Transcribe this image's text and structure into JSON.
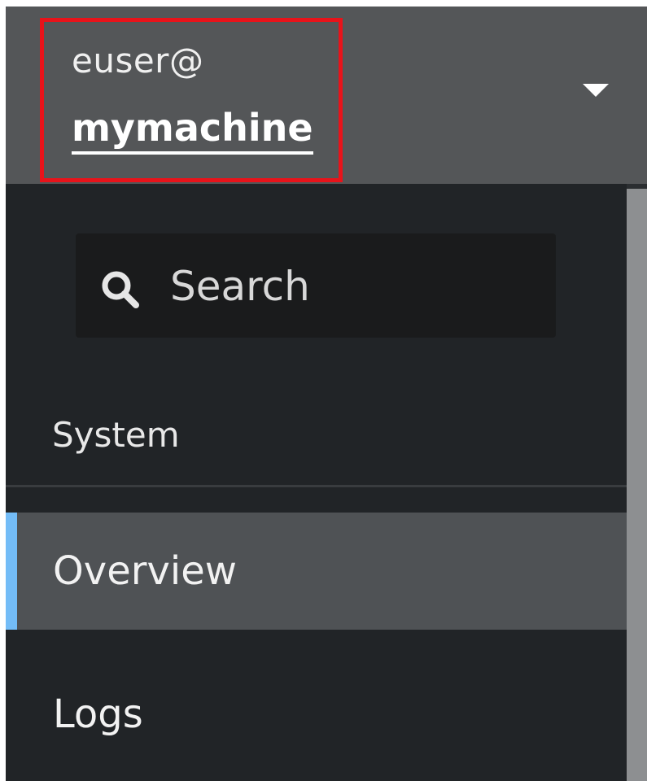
{
  "host": {
    "user": "euser@",
    "machine": "mymachine",
    "dropdown_icon": "caret-down-icon"
  },
  "search": {
    "placeholder": "Search",
    "icon": "search-icon"
  },
  "nav": {
    "section_title": "System",
    "items": [
      {
        "label": "Overview",
        "active": true
      },
      {
        "label": "Logs",
        "active": false
      }
    ]
  },
  "colors": {
    "header_bg": "#545658",
    "nav_bg": "#212427",
    "active_bg": "#4f5255",
    "active_accent": "#73bcf7",
    "highlight": "#e8131a"
  }
}
